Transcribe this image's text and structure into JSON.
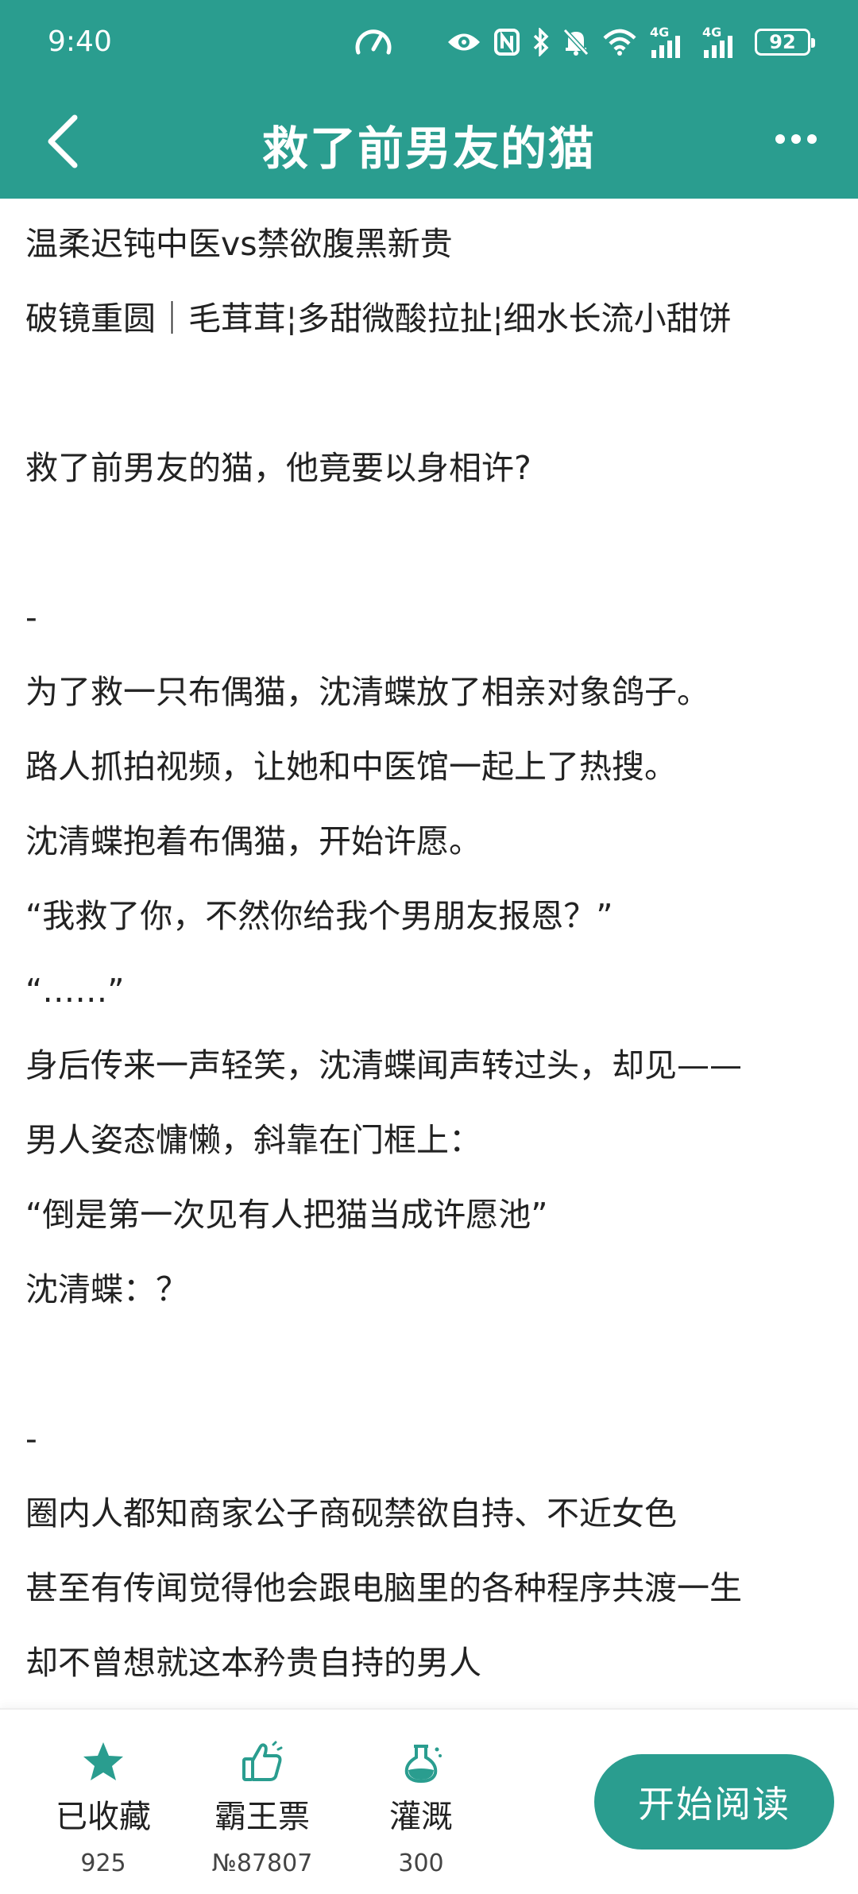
{
  "status_bar": {
    "time": "9:40",
    "battery": "92",
    "network_1": "4G",
    "network_2": "4G",
    "icons": [
      "speedometer-icon",
      "eye-icon",
      "nfc-icon",
      "bluetooth-icon",
      "mute-bell-icon",
      "wifi-icon",
      "signal-icon",
      "signal-icon",
      "battery-icon"
    ]
  },
  "header": {
    "title": "救了前男友的猫",
    "back_icon": "chevron-left-icon",
    "more_icon": "more-horizontal-icon"
  },
  "content": {
    "lines": [
      "温柔迟钝中医vs禁欲腹黑新贵",
      "破镜重圆｜毛茸茸¦多甜微酸拉扯¦细水长流小甜饼",
      "",
      "救了前男友的猫，他竟要以身相许?",
      "",
      "-",
      "为了救一只布偶猫，沈清蝶放了相亲对象鸽子。",
      "路人抓拍视频，让她和中医馆一起上了热搜。",
      "沈清蝶抱着布偶猫，开始许愿。",
      "“我救了你，不然你给我个男朋友报恩？”",
      "“……”",
      "身后传来一声轻笑，沈清蝶闻声转过头，却见——",
      "男人姿态慵懒，斜靠在门框上：",
      "“倒是第一次见有人把猫当成许愿池”",
      "沈清蝶：？",
      "",
      "-",
      "圈内人都知商家公子商砚禁欲自持、不近女色",
      "甚至有传闻觉得他会跟电脑里的各种程序共渡一生",
      "却不曾想就这本矜贵自持的男人"
    ]
  },
  "bottom_bar": {
    "favorite": {
      "label": "已收藏",
      "count": "925",
      "icon": "star-icon"
    },
    "ticket": {
      "label": "霸王票",
      "count": "№87807",
      "icon": "thumbs-up-icon"
    },
    "water": {
      "label": "灌溉",
      "count": "300",
      "icon": "watering-flask-icon"
    },
    "read_button": "开始阅读"
  },
  "colors": {
    "accent": "#2a9d8f",
    "text": "#222222",
    "background": "#ffffff"
  }
}
